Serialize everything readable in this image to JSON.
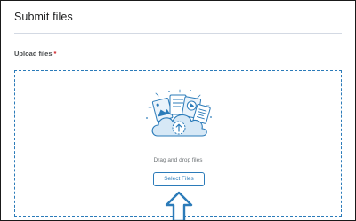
{
  "page": {
    "title": "Submit files"
  },
  "upload": {
    "label": "Upload files",
    "required_marker": "*",
    "dropzone_text": "Drag and drop files",
    "select_button_label": "Select Files"
  },
  "icons": {
    "illustration": "cloud-upload-documents-icon",
    "pointer": "up-arrow-icon"
  },
  "colors": {
    "accent": "#2b7bb9",
    "required": "#cd2026",
    "title": "#202122",
    "text": "#494c4e",
    "muted": "#6e7376"
  }
}
